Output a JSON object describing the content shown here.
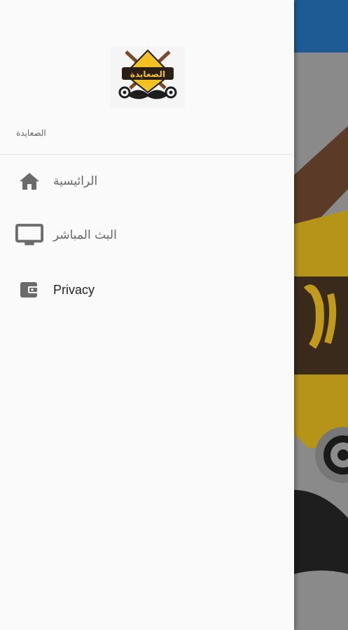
{
  "drawer": {
    "header_title": "الصعايدة",
    "logo_text": "الصعايدة",
    "items": [
      {
        "label": "الرائيسية",
        "icon": "home-icon"
      },
      {
        "label": "البث المباشر",
        "icon": "tv-icon"
      },
      {
        "label": "Privacy",
        "icon": "wallet-icon"
      }
    ]
  },
  "colors": {
    "appbar": "#1e5a93",
    "drawer_bg": "#fafafa",
    "icon": "#6b6b6b",
    "logo_yellow": "#f3c221"
  }
}
